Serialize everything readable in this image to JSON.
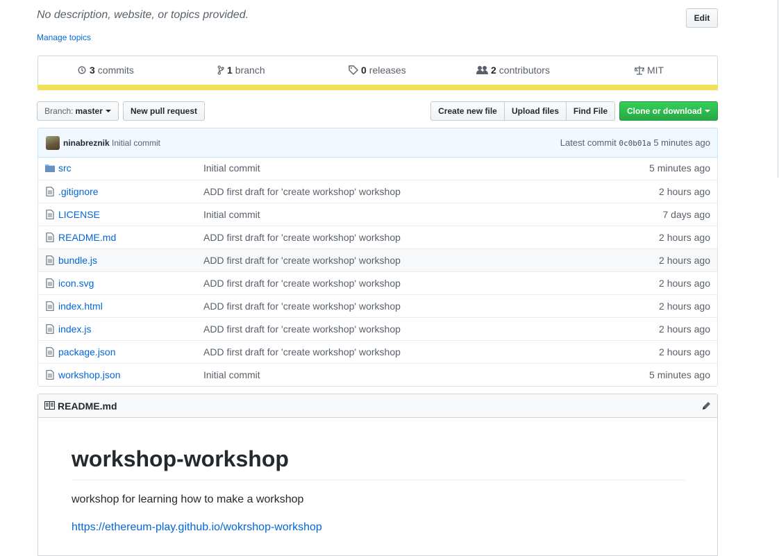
{
  "repo": {
    "description": "No description, website, or topics provided.",
    "edit_label": "Edit",
    "manage_topics_label": "Manage topics"
  },
  "summary": {
    "commits": {
      "count": "3",
      "label": "commits"
    },
    "branches": {
      "count": "1",
      "label": "branch"
    },
    "releases": {
      "count": "0",
      "label": "releases"
    },
    "contributors": {
      "count": "2",
      "label": "contributors"
    },
    "license": {
      "label": "MIT"
    },
    "language_color": "#f1e05a"
  },
  "toolbar": {
    "branch_prefix": "Branch:",
    "branch_name": "master",
    "new_pr_label": "New pull request",
    "create_file_label": "Create new file",
    "upload_label": "Upload files",
    "find_file_label": "Find File",
    "clone_label": "Clone or download"
  },
  "latest_commit": {
    "author": "ninabreznik",
    "message": "Initial commit",
    "prefix": "Latest commit",
    "sha": "0c0b01a",
    "age": "5 minutes ago"
  },
  "files": [
    {
      "name": "src",
      "type": "folder-icon",
      "message": "Initial commit",
      "age": "5 minutes ago"
    },
    {
      "name": ".gitignore",
      "type": "file-icon",
      "message": "ADD first draft for 'create workshop' workshop",
      "age": "2 hours ago"
    },
    {
      "name": "LICENSE",
      "type": "file-icon",
      "message": "Initial commit",
      "age": "7 days ago"
    },
    {
      "name": "README.md",
      "type": "file-icon",
      "message": "ADD first draft for 'create workshop' workshop",
      "age": "2 hours ago"
    },
    {
      "name": "bundle.js",
      "type": "file-icon",
      "message": "ADD first draft for 'create workshop' workshop",
      "age": "2 hours ago"
    },
    {
      "name": "icon.svg",
      "type": "file-icon",
      "message": "ADD first draft for 'create workshop' workshop",
      "age": "2 hours ago"
    },
    {
      "name": "index.html",
      "type": "file-icon",
      "message": "ADD first draft for 'create workshop' workshop",
      "age": "2 hours ago"
    },
    {
      "name": "index.js",
      "type": "file-icon",
      "message": "ADD first draft for 'create workshop' workshop",
      "age": "2 hours ago"
    },
    {
      "name": "package.json",
      "type": "file-icon",
      "message": "ADD first draft for 'create workshop' workshop",
      "age": "2 hours ago"
    },
    {
      "name": "workshop.json",
      "type": "file-icon",
      "message": "Initial commit",
      "age": "5 minutes ago"
    }
  ],
  "readme": {
    "file_label": "README.md",
    "heading": "workshop-workshop",
    "paragraph": "workshop for learning how to make a workshop",
    "link": "https://ethereum-play.github.io/wokrshop-workshop"
  },
  "colors": {
    "link": "#0366d6",
    "muted": "#586069",
    "clone_green": "#28a745"
  }
}
